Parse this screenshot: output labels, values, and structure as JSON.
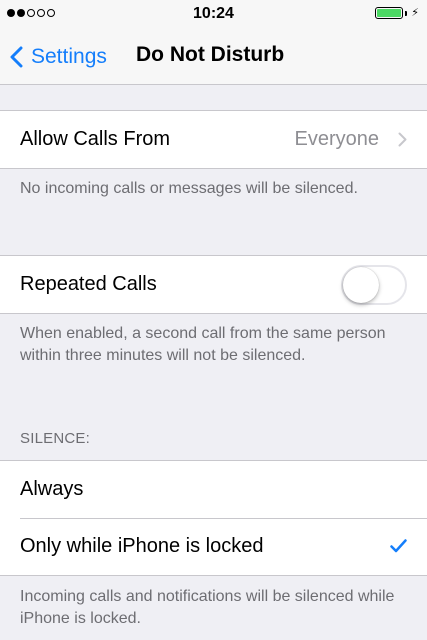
{
  "status_bar": {
    "signal_dots": [
      "filled",
      "filled",
      "empty",
      "empty",
      "empty"
    ],
    "time": "10:24",
    "battery_charging_glyph": "⚡",
    "battery_color": "#4cd964"
  },
  "nav": {
    "back_label": "Settings",
    "title": "Do Not Disturb",
    "accent_color": "#147efb"
  },
  "allow_calls": {
    "label": "Allow Calls From",
    "value": "Everyone",
    "footer": "No incoming calls or messages will be silenced."
  },
  "repeated_calls": {
    "label": "Repeated Calls",
    "enabled": false,
    "footer": "When enabled, a second call from the same person within three minutes will not be silenced."
  },
  "silence": {
    "header": "SILENCE:",
    "options": [
      {
        "label": "Always",
        "selected": false
      },
      {
        "label": "Only while iPhone is locked",
        "selected": true
      }
    ],
    "footer": "Incoming calls and notifications will be silenced while iPhone is locked."
  },
  "icons": [
    "signal-dots-icon",
    "battery-icon",
    "charging-bolt-icon",
    "back-chevron-icon",
    "disclosure-chevron-icon",
    "checkmark-icon"
  ]
}
